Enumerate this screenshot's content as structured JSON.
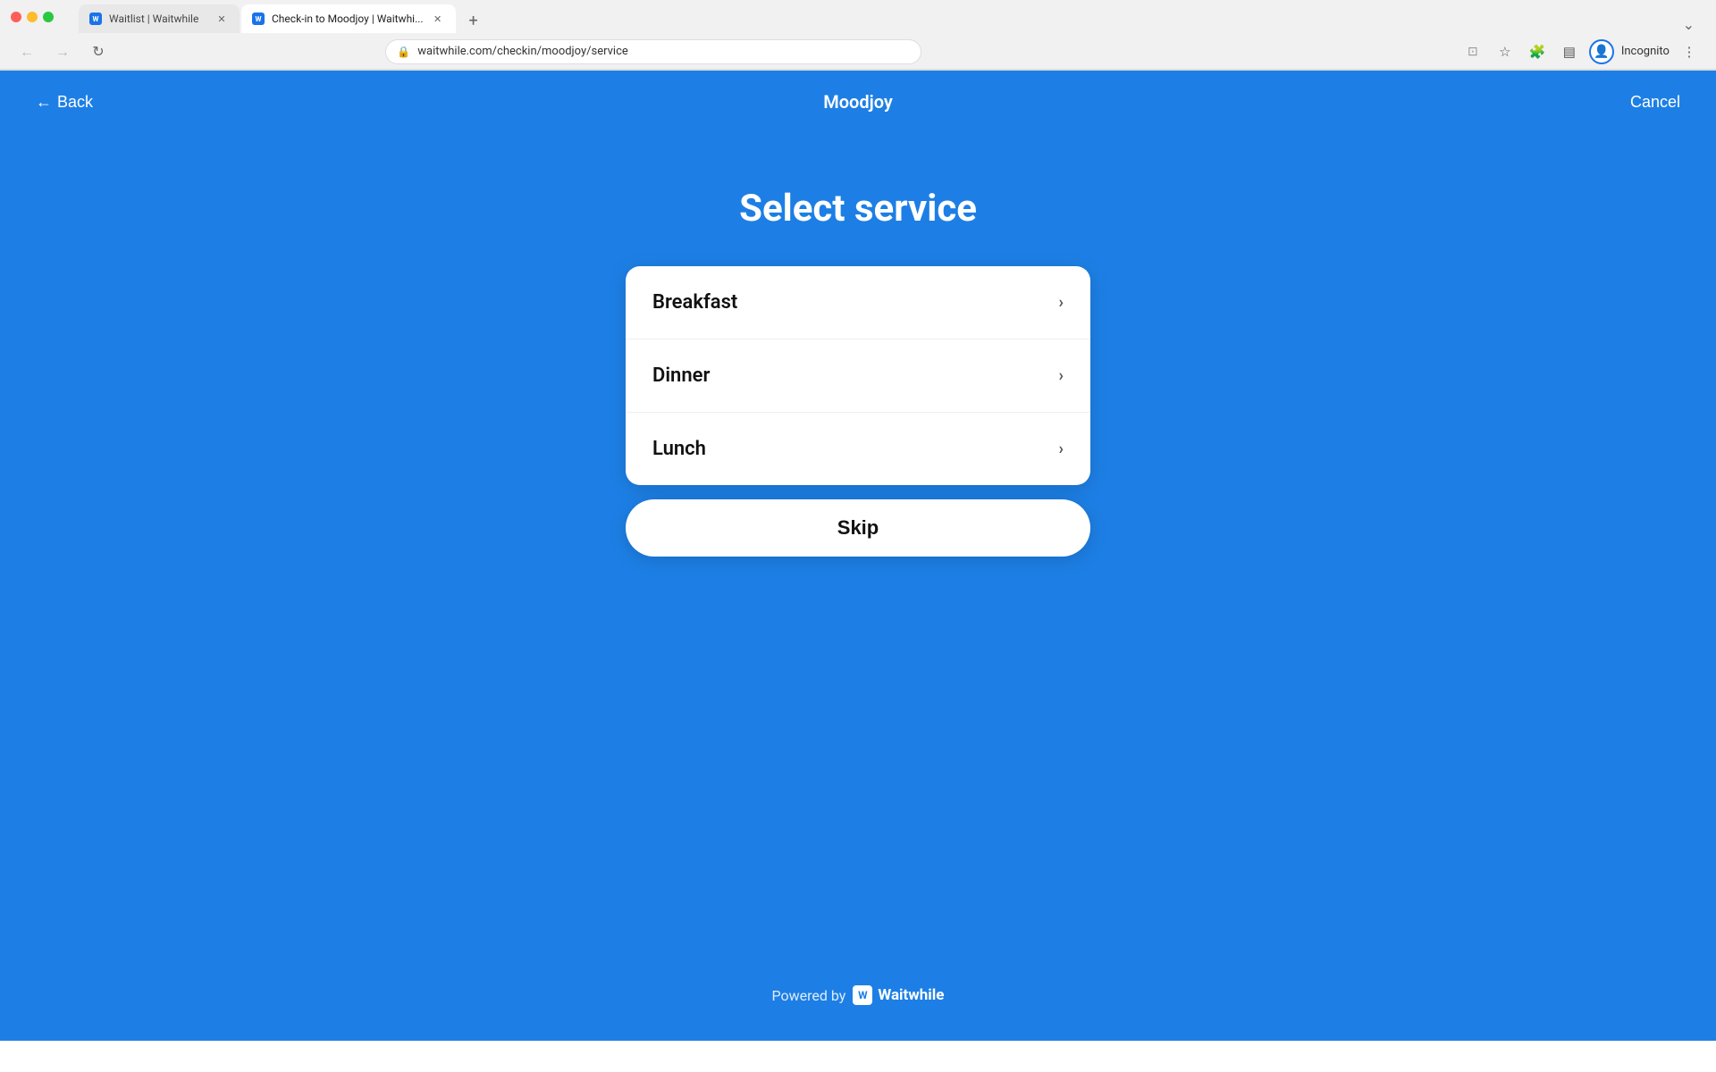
{
  "browser": {
    "tabs": [
      {
        "id": "tab1",
        "title": "Waitlist | Waitwhile",
        "favicon": "W",
        "active": false,
        "url": ""
      },
      {
        "id": "tab2",
        "title": "Check-in to Moodjoy | Waitwhi...",
        "favicon": "W",
        "active": true,
        "url": "waitwhile.com/checkin/moodjoy/service"
      }
    ],
    "address": "waitwhile.com/checkin/moodjoy/service",
    "profile_label": "Incognito"
  },
  "page": {
    "brand": "Moodjoy",
    "back_label": "Back",
    "cancel_label": "Cancel",
    "title": "Select service",
    "services": [
      {
        "id": "breakfast",
        "name": "Breakfast"
      },
      {
        "id": "dinner",
        "name": "Dinner"
      },
      {
        "id": "lunch",
        "name": "Lunch"
      }
    ],
    "skip_label": "Skip",
    "footer": {
      "powered_by": "Powered by",
      "brand": "Waitwhile"
    }
  }
}
